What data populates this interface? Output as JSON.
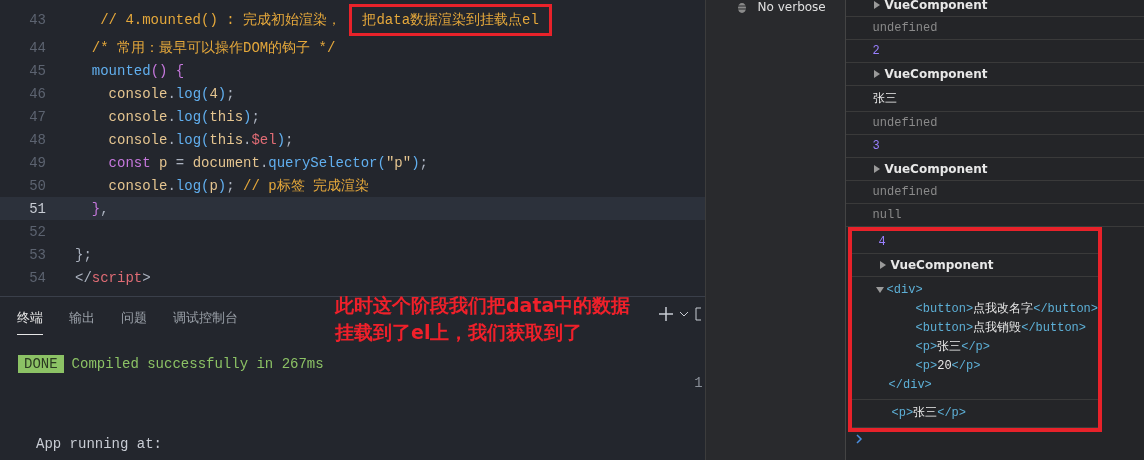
{
  "editor": {
    "lines": [
      {
        "number": "43",
        "current": false,
        "tokens": [
          {
            "t": "   // 4.mounted() : 完成初始渲染， ",
            "kind": "comment"
          },
          {
            "t": "把data数据渲染到挂载点el",
            "kind": "comment",
            "boxed": true
          }
        ]
      },
      {
        "number": "44",
        "current": false,
        "tokens": [
          {
            "t": "  /* 常用：最早可以操作DOM的钩子 */",
            "kind": "comment"
          }
        ]
      },
      {
        "number": "45",
        "current": false,
        "tokens": [
          {
            "t": "  mounted",
            "kind": "func"
          },
          {
            "t": "()",
            "kind": "brace"
          },
          {
            "t": " {",
            "kind": "brace"
          }
        ]
      },
      {
        "number": "46",
        "current": false,
        "tokens": [
          {
            "t": "    console",
            "kind": "var"
          },
          {
            "t": ".",
            "kind": "plain"
          },
          {
            "t": "log",
            "kind": "func"
          },
          {
            "t": "(",
            "kind": "func"
          },
          {
            "t": "4",
            "kind": "var"
          },
          {
            "t": ")",
            "kind": "func"
          },
          {
            "t": ";",
            "kind": "plain"
          }
        ]
      },
      {
        "number": "47",
        "current": false,
        "tokens": [
          {
            "t": "    console",
            "kind": "var"
          },
          {
            "t": ".",
            "kind": "plain"
          },
          {
            "t": "log",
            "kind": "func"
          },
          {
            "t": "(",
            "kind": "func"
          },
          {
            "t": "this",
            "kind": "var"
          },
          {
            "t": ")",
            "kind": "func"
          },
          {
            "t": ";",
            "kind": "plain"
          }
        ]
      },
      {
        "number": "48",
        "current": false,
        "tokens": [
          {
            "t": "    console",
            "kind": "var"
          },
          {
            "t": ".",
            "kind": "plain"
          },
          {
            "t": "log",
            "kind": "func"
          },
          {
            "t": "(",
            "kind": "func"
          },
          {
            "t": "this",
            "kind": "var"
          },
          {
            "t": ".",
            "kind": "plain"
          },
          {
            "t": "$el",
            "kind": "tag"
          },
          {
            "t": ")",
            "kind": "func"
          },
          {
            "t": ";",
            "kind": "plain"
          }
        ]
      },
      {
        "number": "49",
        "current": false,
        "tokens": [
          {
            "t": "    const",
            "kind": "keyword"
          },
          {
            "t": " p ",
            "kind": "var"
          },
          {
            "t": "= ",
            "kind": "plain"
          },
          {
            "t": "document",
            "kind": "var"
          },
          {
            "t": ".",
            "kind": "plain"
          },
          {
            "t": "querySelector",
            "kind": "func"
          },
          {
            "t": "(",
            "kind": "func"
          },
          {
            "t": "\"p\"",
            "kind": "var"
          },
          {
            "t": ")",
            "kind": "func"
          },
          {
            "t": ";",
            "kind": "plain"
          }
        ]
      },
      {
        "number": "50",
        "current": false,
        "tokens": [
          {
            "t": "    console",
            "kind": "var"
          },
          {
            "t": ".",
            "kind": "plain"
          },
          {
            "t": "log",
            "kind": "func"
          },
          {
            "t": "(",
            "kind": "func"
          },
          {
            "t": "p",
            "kind": "var"
          },
          {
            "t": ")",
            "kind": "func"
          },
          {
            "t": "; ",
            "kind": "plain"
          },
          {
            "t": "// p标签 完成渲染",
            "kind": "comment"
          }
        ]
      },
      {
        "number": "51",
        "current": true,
        "tokens": [
          {
            "t": "  }",
            "kind": "brace"
          },
          {
            "t": ",",
            "kind": "plain"
          }
        ]
      },
      {
        "number": "52",
        "current": false
      },
      {
        "number": "53",
        "current": false,
        "tokens": [
          {
            "t": "};",
            "kind": "plain"
          }
        ]
      },
      {
        "number": "54",
        "current": false,
        "tokens": [
          {
            "t": "</",
            "kind": "plain"
          },
          {
            "t": "script",
            "kind": "tag"
          },
          {
            "t": ">",
            "kind": "plain"
          }
        ]
      }
    ]
  },
  "annotation": {
    "lines": [
      "此时这个阶段我们把data中的数据",
      "挂载到了el上，我们获取到了"
    ]
  },
  "panel": {
    "tabs": [
      {
        "label": "终端",
        "selected": true
      },
      {
        "label": "输出",
        "selected": false
      },
      {
        "label": "问题",
        "selected": false
      },
      {
        "label": "调试控制台",
        "selected": false
      }
    ]
  },
  "terminal": {
    "badge": "DONE",
    "message": "Compiled successfully in 267ms",
    "side_text": "1",
    "lines": [
      "App running at:"
    ]
  },
  "devtools": {
    "sidebar": {
      "items": [
        {
          "label": "No verbose"
        }
      ]
    },
    "console": {
      "entries": [
        {
          "kind": "object",
          "text": "VueComponent",
          "expanded": false,
          "boxed": false
        },
        {
          "kind": "empty",
          "text": "undefined",
          "boxed": false
        },
        {
          "kind": "number",
          "text": "2",
          "boxed": false
        },
        {
          "kind": "object",
          "text": "VueComponent",
          "expanded": false,
          "boxed": false
        },
        {
          "kind": "string",
          "text": "张三",
          "boxed": false
        },
        {
          "kind": "empty",
          "text": "undefined",
          "boxed": false
        },
        {
          "kind": "number",
          "text": "3",
          "boxed": false
        },
        {
          "kind": "object",
          "text": "VueComponent",
          "expanded": false,
          "boxed": false
        },
        {
          "kind": "empty",
          "text": "undefined",
          "boxed": false
        },
        {
          "kind": "empty",
          "text": "null",
          "boxed": false
        },
        {
          "kind": "number",
          "text": "4",
          "boxed": true
        },
        {
          "kind": "object",
          "text": "VueComponent",
          "expanded": false,
          "boxed": true
        },
        {
          "kind": "element",
          "open": "<div>",
          "close": "</div>",
          "expanded": true,
          "boxed": true,
          "children": [
            {
              "open": "<button>",
              "text": "点我改名字",
              "close": "</button>"
            },
            {
              "open": "<button>",
              "text": "点我销毁",
              "close": "</button>"
            },
            {
              "open": "<p>",
              "text": "张三",
              "close": "</p>"
            },
            {
              "open": "<p>",
              "text": "20",
              "close": "</p>"
            }
          ]
        },
        {
          "kind": "element",
          "open": "<p>",
          "text": "张三",
          "close": "</p>",
          "boxed": true
        }
      ]
    }
  }
}
